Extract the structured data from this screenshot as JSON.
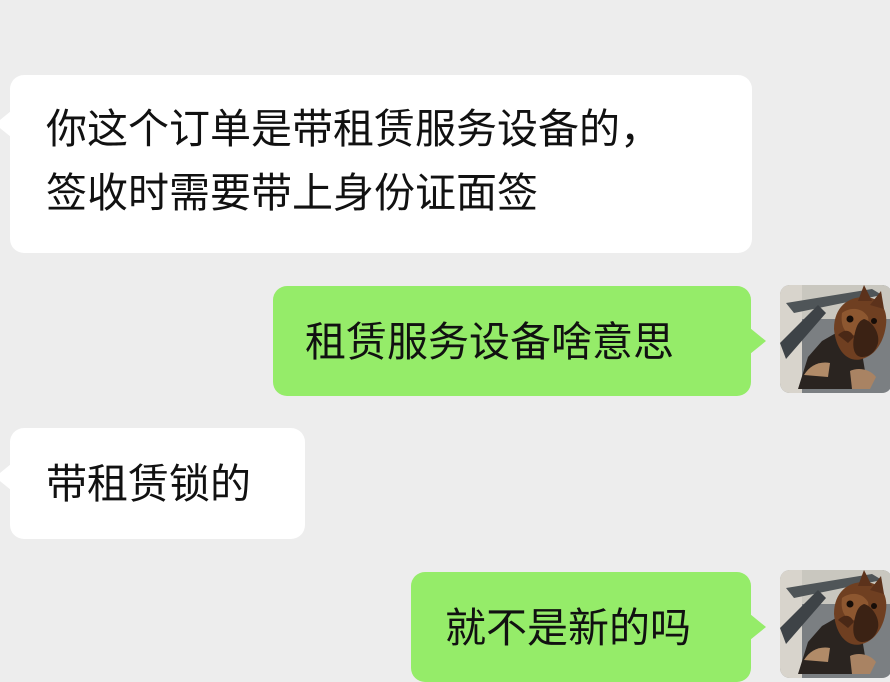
{
  "messages": [
    {
      "side": "incoming",
      "lines": [
        "你这个订单是带租赁服务设备的，",
        "签收时需要带上身份证面签"
      ]
    },
    {
      "side": "outgoing",
      "lines": [
        "租赁服务设备啥意思"
      ]
    },
    {
      "side": "incoming",
      "lines": [
        "带租赁锁的"
      ]
    },
    {
      "side": "outgoing",
      "lines": [
        "就不是新的吗"
      ]
    }
  ],
  "avatar": {
    "icon": "horse-mask-avatar-icon"
  },
  "colors": {
    "background": "#ededed",
    "incoming_bubble": "#ffffff",
    "outgoing_bubble": "#95ec69",
    "text": "#111111"
  }
}
